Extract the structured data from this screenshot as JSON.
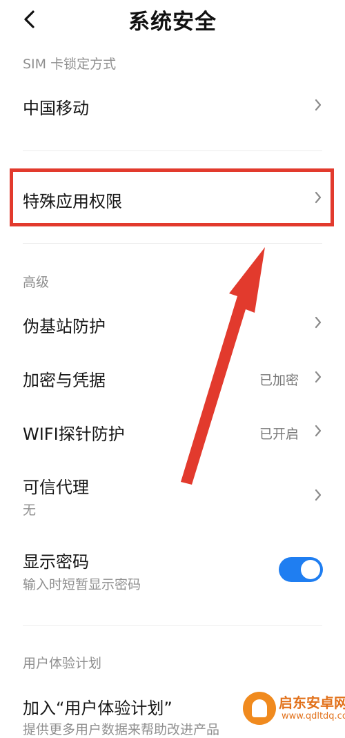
{
  "header": {
    "title": "系统安全"
  },
  "sim": {
    "section_title": "SIM 卡锁定方式",
    "carrier_label": "中国移动"
  },
  "special": {
    "label": "特殊应用权限"
  },
  "advanced": {
    "section_title": "高级",
    "fake_base_label": "伪基站防护",
    "encryption_label": "加密与凭据",
    "encryption_value": "已加密",
    "wifi_label": "WIFI探针防护",
    "wifi_value": "已开启",
    "trust_label": "可信代理",
    "trust_sub": "无",
    "password_label": "显示密码",
    "password_sub": "输入时短暂显示密码",
    "password_enabled": true
  },
  "ux": {
    "section_title": "用户体验计划",
    "join_label": "加入“用户体验计划”",
    "join_sub": "提供更多用户数据来帮助改进产品"
  },
  "watermark": {
    "name": "启东安卓网",
    "url": "www.qdltdq.com"
  },
  "colors": {
    "accent": "#1f7ef1",
    "annotation": "#e23a2d",
    "watermark": "#e2721c"
  }
}
